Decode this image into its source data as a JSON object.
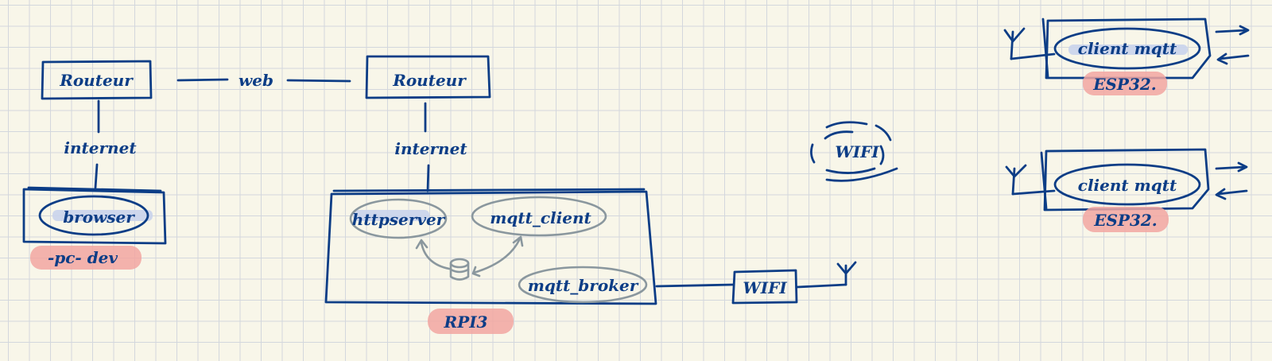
{
  "labels": {
    "router_left": "Routeur",
    "router_right": "Routeur",
    "web_link": "web",
    "internet_left": "internet",
    "internet_right": "internet",
    "browser": "browser",
    "pc_dev": "-pc- dev",
    "httpserver": "httpserver",
    "mqtt_client": "mqtt_client",
    "mqtt_broker": "mqtt_broker",
    "rpi3": "RPI3",
    "wifi_box": "WIFI",
    "wifi_cloud": "WIFI",
    "client_mqtt_1": "client mqtt",
    "esp32_1": "ESP32.",
    "client_mqtt_2": "client mqtt",
    "esp32_2": "ESP32."
  },
  "colors": {
    "ink": "#0c3d86",
    "grey_ink": "#8a979e",
    "highlight_red": "#f2a6a1",
    "highlight_blue": "#c9d4ec",
    "paper": "#f8f6e9",
    "grid": "#d3d7dd"
  },
  "icons": [
    "antenna-icon",
    "database-icon",
    "arrow-right-icon",
    "arrow-left-icon"
  ]
}
